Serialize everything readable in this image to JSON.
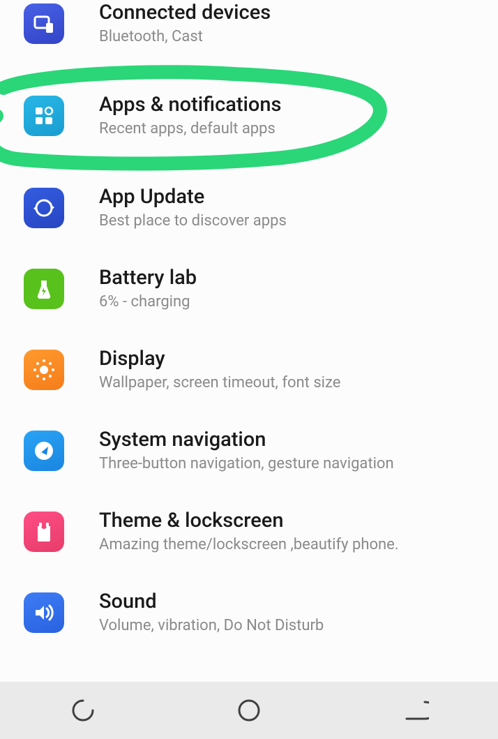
{
  "settings": [
    {
      "title": "Connected devices",
      "subtitle": "Bluetooth, Cast"
    },
    {
      "title": "Apps & notifications",
      "subtitle": "Recent apps, default apps"
    },
    {
      "title": "App Update",
      "subtitle": "Best place to discover apps"
    },
    {
      "title": "Battery lab",
      "subtitle": "6% - charging"
    },
    {
      "title": "Display",
      "subtitle": "Wallpaper, screen timeout, font size"
    },
    {
      "title": "System navigation",
      "subtitle": "Three-button navigation, gesture navigation"
    },
    {
      "title": "Theme & lockscreen",
      "subtitle": "Amazing theme/lockscreen ,beautify phone."
    },
    {
      "title": "Sound",
      "subtitle": "Volume, vibration, Do Not Disturb"
    }
  ]
}
